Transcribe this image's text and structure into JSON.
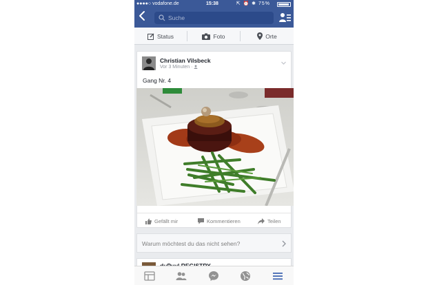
{
  "status_bar": {
    "carrier": "●●●●○ vodafone.de",
    "time": "15:38",
    "icons_text": "⇱ ⏰ ✱ 75%"
  },
  "nav": {
    "search_placeholder": "Suche",
    "back_icon": "chevron-left-icon",
    "friends_icon": "friend-requests-icon"
  },
  "composer": {
    "status_label": "Status",
    "photo_label": "Foto",
    "places_label": "Orte"
  },
  "post": {
    "author": "Christian Vilsbeck",
    "meta": "Vor 3 Minuten · ",
    "caption": "Gang Nr. 4",
    "actions": {
      "like_label": "Gefällt mir",
      "comment_label": "Kommentieren",
      "share_label": "Teilen"
    }
  },
  "hide_prompt": {
    "text": "Warum möchtest du das nicht sehen?"
  },
  "next_post": {
    "name": "duPuyl REGISTRY"
  },
  "tabs": [
    "news-feed-icon",
    "friends-icon",
    "messenger-icon",
    "globe-icon",
    "more-menu-icon"
  ],
  "colors": {
    "brand_blue": "#3b5998",
    "active_tab": "#4267b2"
  }
}
